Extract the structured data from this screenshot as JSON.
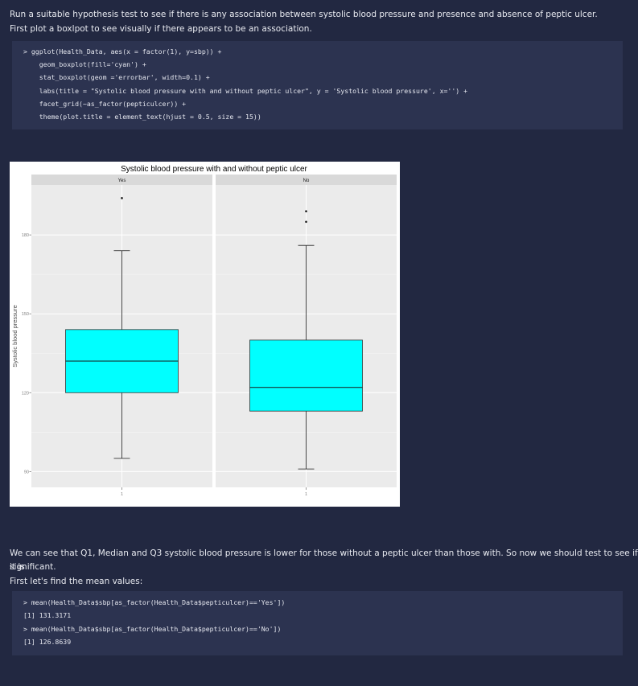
{
  "intro": {
    "line1": "Run a suitable hypothesis test to see if there is any association between systolic blood pressure and presence and absence of peptic ulcer.",
    "line2": "First plot a boxlpot to see visually if there appears to be an association."
  },
  "code1": [
    "> ggplot(Health_Data, aes(x = factor(1), y=sbp)) +",
    "    geom_boxplot(fill='cyan') +",
    "    stat_boxplot(geom ='errorbar', width=0.1) +",
    "    labs(title = \"Systolic blood pressure with and without peptic ulcer\", y = 'Systolic blood pressure', x='') +",
    "    facet_grid(~as_factor(pepticulcer)) +",
    "    theme(plot.title = element_text(hjust = 0.5, size = 15))"
  ],
  "chart_data": {
    "type": "boxplot",
    "title": "Systolic blood pressure with and without peptic ulcer",
    "ylabel": "Systolic blood pressure",
    "xlabel": "",
    "ylim": [
      84,
      199
    ],
    "yticks": [
      90,
      120,
      150,
      180
    ],
    "grid": true,
    "panels": [
      {
        "name": "Yes",
        "x_tick": "1",
        "lower_whisker": 95,
        "q1": 120,
        "median": 132,
        "q3": 144,
        "upper_whisker": 174,
        "outliers": [
          194
        ]
      },
      {
        "name": "No",
        "x_tick": "1",
        "lower_whisker": 91,
        "q1": 113,
        "median": 122,
        "q3": 140,
        "upper_whisker": 176,
        "outliers": [
          189,
          185
        ]
      }
    ],
    "colors": {
      "box_fill": "#00ffff",
      "panel_bg": "#ebebeb",
      "strip_bg": "#d9d9d9"
    }
  },
  "analysis": {
    "line1": "We can see that Q1, Median and Q3 systolic blood pressure is lower for those without a peptic ulcer than those with. So now we should test to see if it is",
    "line2": "significant.",
    "line3": "First let's find the mean values:"
  },
  "code2": [
    "> mean(Health_Data$sbp[as_factor(Health_Data$pepticulcer)=='Yes'])",
    "[1] 131.3171",
    "> mean(Health_Data$sbp[as_factor(Health_Data$pepticulcer)=='No'])",
    "[1] 126.8639"
  ]
}
